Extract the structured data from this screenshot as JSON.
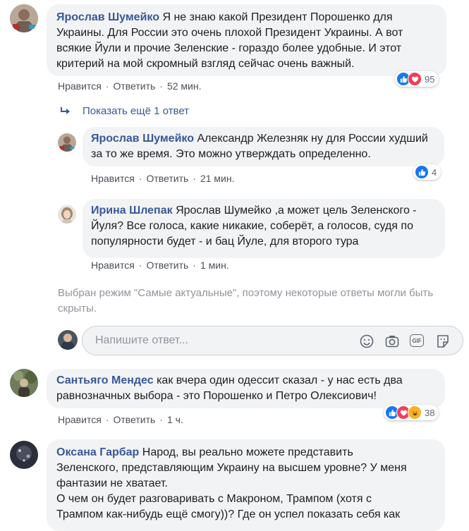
{
  "comments": [
    {
      "author": "Ярослав Шумейко",
      "text": "Я не знаю какой Президент Порошенко для Украины. Для России это очень плохой Президент Украины. А вот всякие Йули и прочие Зеленские - гораздо более удобные. И этот критерий на мой скромный взгляд сейчас очень важный.",
      "like": "Нравится",
      "reply": "Ответить",
      "time": "52 мин.",
      "reactions_count": "95"
    },
    {
      "author": "Ярослав Шумейко",
      "text": "Александр Железняк ну для России худший за то же время. Это можно утверждать определенно.",
      "like": "Нравится",
      "reply": "Ответить",
      "time": "21 мин.",
      "reactions_count": "4"
    },
    {
      "author": "Ирина Шлепак",
      "text": "Ярослав Шумейко ,а может цель Зеленского - Йуля? Все голоса, какие никакие, соберёт, а голосов, судя по популярности будет - и бац Йуле, для второго тура",
      "like": "Нравится",
      "reply": "Ответить",
      "time": "1 мин."
    },
    {
      "author": "Сантьяго Мендес",
      "text": "как вчера один одессит сказал - у нас есть два равнозначных выбора - это Порошенко и Петро Олексиович!",
      "like": "Нравится",
      "reply": "Ответить",
      "time": "1 ч.",
      "reactions_count": "38"
    },
    {
      "author": "Оксана Гарбар",
      "text_lines": [
        "Народ, вы реально можете представить",
        "Зеленского, представляющим Украину на высшем уровне? У меня",
        "фантазии не хватает.",
        "О чем он будет разговаривать с Макроном, Трампом (хотя с",
        "Трампом как-нибудь ещё смогу))? Где он успел показать себя как"
      ]
    }
  ],
  "show_more": "Показать ещё 1 ответ",
  "notice": "Выбран режим \"Самые актуальные\", поэтому некоторые ответы могли быть скрыты.",
  "reply_placeholder": "Напишите ответ...",
  "gif_label": "GIF",
  "colors": {
    "link": "#385898",
    "like": "#1877f2",
    "love": "#f33e58",
    "haha": "#f7b125",
    "bubble": "#f2f3f5"
  }
}
